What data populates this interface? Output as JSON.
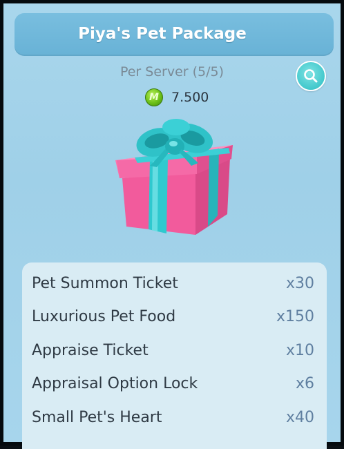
{
  "title": "Piya's Pet Package",
  "limit_text": "Per Server (5/5)",
  "price": {
    "currency_icon": "maple-point-coin-icon",
    "currency_letter": "M",
    "amount": "7.500"
  },
  "zoom_icon": "magnifier-icon",
  "package_image": "gift-box-icon",
  "items": [
    {
      "name": "Pet Summon Ticket",
      "qty": "x30"
    },
    {
      "name": "Luxurious Pet Food",
      "qty": "x150"
    },
    {
      "name": "Appraise Ticket",
      "qty": "x10"
    },
    {
      "name": "Appraisal Option Lock",
      "qty": "x6"
    },
    {
      "name": "Small Pet's Heart",
      "qty": "x40"
    }
  ],
  "colors": {
    "background": "#a9d6ec",
    "title_bar": "#6fb7da",
    "gift_box": "#f25b9c",
    "ribbon": "#28c6cc",
    "panel": "#d9ecf4",
    "quantity_text": "#5f7fa0"
  }
}
